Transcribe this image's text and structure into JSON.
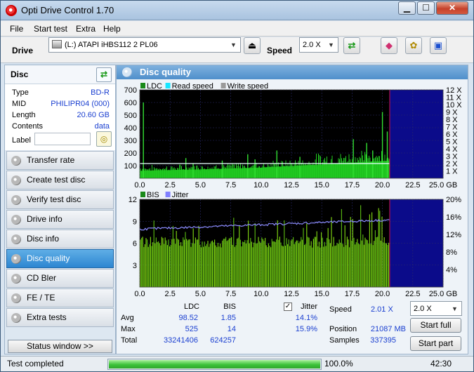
{
  "window": {
    "title": "Opti Drive Control 1.70"
  },
  "menu": [
    "File",
    "Start test",
    "Extra",
    "Help"
  ],
  "toolbar": {
    "drive_label": "Drive",
    "drive_value": "(L:)   ATAPI iHBS112   2 PL06",
    "speed_label": "Speed",
    "speed_value": "2.0 X"
  },
  "sidebar": {
    "disc_title": "Disc",
    "info": [
      {
        "key": "Type",
        "value": "BD-R"
      },
      {
        "key": "MID",
        "value": "PHILIPR04 (000)"
      },
      {
        "key": "Length",
        "value": "20.60 GB"
      },
      {
        "key": "Contents",
        "value": "data"
      }
    ],
    "label_key": "Label",
    "nav": [
      "Transfer rate",
      "Create test disc",
      "Verify test disc",
      "Drive info",
      "Disc info",
      "Disc quality",
      "CD Bler",
      "FE / TE",
      "Extra tests"
    ],
    "active_index": 5,
    "status_window": "Status window >>"
  },
  "panel": {
    "title": "Disc quality"
  },
  "chart_data": [
    {
      "type": "area",
      "legend": [
        "LDC",
        "Read speed",
        "Write speed"
      ],
      "legend_colors": [
        "#1a8a1a",
        "#19e6ff",
        "#9a9a9a"
      ],
      "x_ticks": [
        "0.0",
        "2.5",
        "5.0",
        "7.5",
        "10.0",
        "12.5",
        "15.0",
        "17.5",
        "20.0",
        "22.5",
        "25.0 GB"
      ],
      "y_left_ticks": [
        "100",
        "200",
        "300",
        "400",
        "500",
        "600",
        "700"
      ],
      "y_right_ticks": [
        "1 X",
        "2 X",
        "3 X",
        "4 X",
        "5 X",
        "6 X",
        "7 X",
        "8 X",
        "9 X",
        "10 X",
        "11 X",
        "12 X"
      ],
      "xlim": [
        0,
        25
      ],
      "ylim": [
        0,
        700
      ],
      "data_end": 20.6,
      "ldc_baseline": [
        {
          "x": 0,
          "y": 60
        },
        {
          "x": 5,
          "y": 70
        },
        {
          "x": 10,
          "y": 85
        },
        {
          "x": 15,
          "y": 110
        },
        {
          "x": 20.6,
          "y": 140
        }
      ],
      "ldc_spikes": [
        {
          "x": 0.3,
          "y": 600
        },
        {
          "x": 3.8,
          "y": 160
        },
        {
          "x": 4.4,
          "y": 120
        },
        {
          "x": 6.8,
          "y": 140
        },
        {
          "x": 8.9,
          "y": 190
        },
        {
          "x": 9.5,
          "y": 150
        },
        {
          "x": 11.3,
          "y": 220
        },
        {
          "x": 13.2,
          "y": 170
        },
        {
          "x": 17.6,
          "y": 310
        },
        {
          "x": 18.7,
          "y": 280
        },
        {
          "x": 19.2,
          "y": 220
        },
        {
          "x": 20.0,
          "y": 525
        },
        {
          "x": 20.4,
          "y": 370
        }
      ],
      "read_speed_x": 2.0
    },
    {
      "type": "area",
      "legend": [
        "BIS",
        "Jitter"
      ],
      "legend_colors": [
        "#1a8a1a",
        "#8080ff"
      ],
      "x_ticks": [
        "0.0",
        "2.5",
        "5.0",
        "7.5",
        "10.0",
        "12.5",
        "15.0",
        "17.5",
        "20.0",
        "22.5",
        "25.0 GB"
      ],
      "y_left_ticks": [
        "3",
        "6",
        "9",
        "12"
      ],
      "y_right_ticks": [
        "4%",
        "8%",
        "12%",
        "16%",
        "20%"
      ],
      "xlim": [
        0,
        25
      ],
      "ylim": [
        0,
        12
      ],
      "data_end": 20.6,
      "bis_typical": 6,
      "bis_max": 14,
      "jitter_start_pct": 13.2,
      "jitter_end_pct": 15.3
    }
  ],
  "stats": {
    "col_ldc": "LDC",
    "col_bis": "BIS",
    "col_jitter": "Jitter",
    "jitter_checked": true,
    "avg_label": "Avg",
    "avg_ldc": "98.52",
    "avg_bis": "1.85",
    "avg_jitter": "14.1%",
    "max_label": "Max",
    "max_ldc": "525",
    "max_bis": "14",
    "max_jitter": "15.9%",
    "total_label": "Total",
    "total_ldc": "33241406",
    "total_bis": "624257",
    "speed_label": "Speed",
    "speed_value": "2.01 X",
    "position_label": "Position",
    "position_value": "21087 MB",
    "samples_label": "Samples",
    "samples_value": "337395",
    "speed_select": "2.0 X",
    "start_full": "Start full",
    "start_part": "Start part"
  },
  "status": {
    "text": "Test completed",
    "progress_pct": 100,
    "progress_text": "100.0%",
    "time": "42:30"
  }
}
